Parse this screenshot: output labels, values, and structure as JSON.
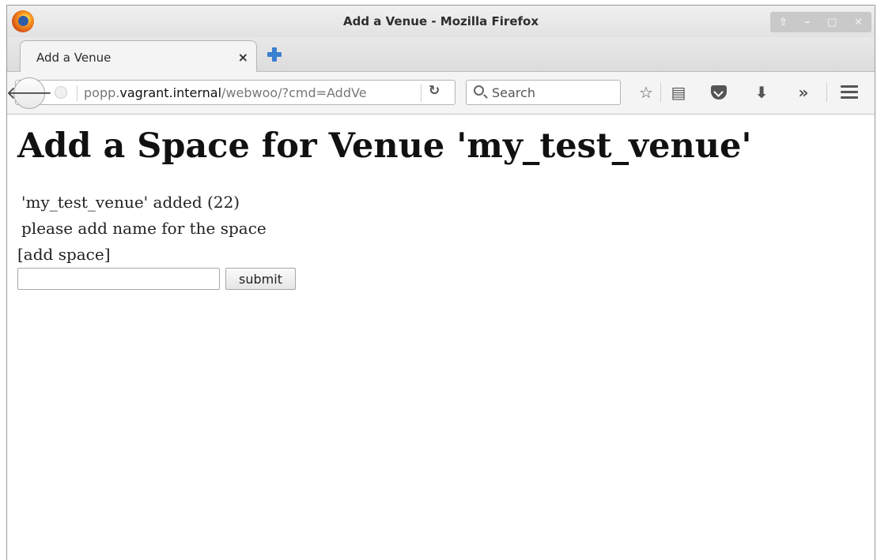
{
  "window": {
    "title": "Add a Venue - Mozilla Firefox"
  },
  "tab": {
    "label": "Add a Venue",
    "close": "×"
  },
  "navbar": {
    "url_prefix": "popp.",
    "url_domain": "vagrant.internal",
    "url_path": "/webwoo/?cmd=AddVe",
    "search_placeholder": "Search"
  },
  "page": {
    "heading": "Add a Space for Venue 'my_test_venue'",
    "messages": [
      "'my_test_venue' added (22)",
      "please add name for the space"
    ],
    "section_label": "[add space]",
    "space_input_value": "",
    "submit_label": "submit"
  }
}
